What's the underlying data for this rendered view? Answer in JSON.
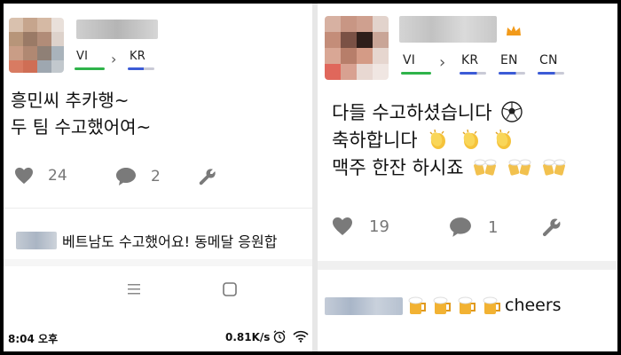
{
  "left": {
    "langs": [
      "VI",
      "KR"
    ],
    "post_lines": [
      "흥민씨 추카행~",
      "두 팀 수고했어여~"
    ],
    "likes": "24",
    "comments": "2",
    "comment_text": "베트남도 수고했어요! 동메달 응원합",
    "status": {
      "time": "8:04 오후",
      "speed": "0.81K/s"
    }
  },
  "right": {
    "langs": [
      "VI",
      "KR",
      "EN",
      "CN"
    ],
    "post_lines": [
      "다들 수고하셨습니다",
      "축하합니다",
      "맥주 한잔 하시죠"
    ],
    "likes": "19",
    "comments": "1",
    "comment_text": "cheers"
  },
  "colors": {
    "green": "#2fb34a",
    "blue": "#3c5bd6",
    "gray_bar": "#c9cad6",
    "action": "#777777"
  },
  "icons": [
    "heart-icon",
    "speech-bubble-icon",
    "wrench-icon",
    "soccer-ball-icon",
    "clapping-hands-icon",
    "beer-mugs-icon",
    "crown-icon",
    "menu-icon",
    "home-square-icon",
    "alarm-clock-icon",
    "wifi-icon"
  ]
}
